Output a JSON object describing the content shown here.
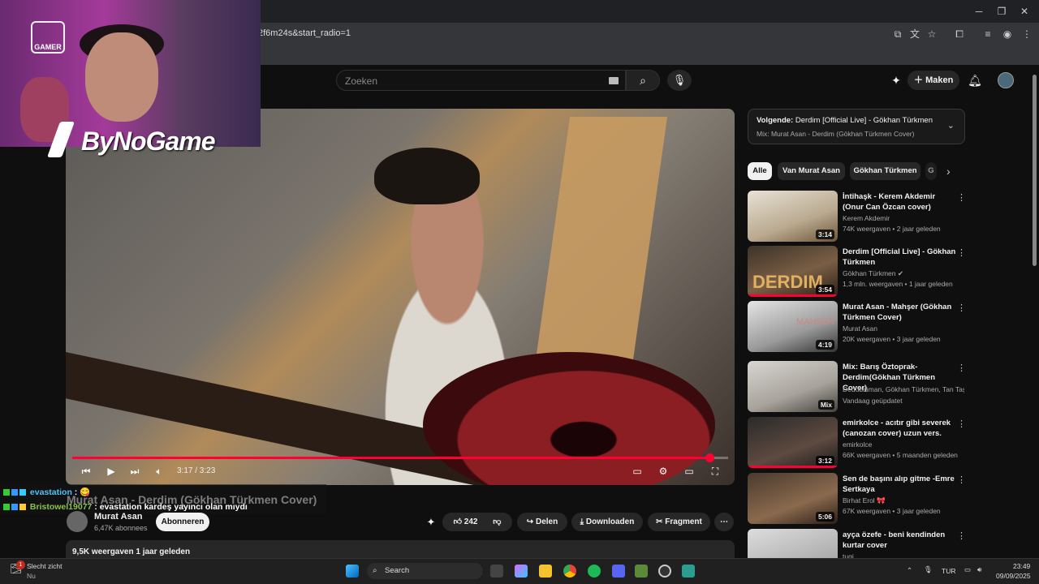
{
  "browser": {
    "url_fragment": "2f6m24s&start_radio=1"
  },
  "header": {
    "search_placeholder": "Zoeken",
    "create_label": "Maken"
  },
  "stream_overlay": {
    "brand": "ByNoGame",
    "logo_text": "GAMER"
  },
  "chat": [
    {
      "user": "evastation",
      "message": " : 😋"
    },
    {
      "user": "Bristowel19077",
      "message": " : evastation kardeş yayıncı olan mıydı"
    }
  ],
  "player": {
    "time": "3:17 / 3:23",
    "progress": 0.975
  },
  "video": {
    "title": "Murat Asan - Derdim (Gökhan Türkmen Cover)",
    "channel": "Murat Asan",
    "subscribers": "6,47K abonnees",
    "subscribe_label": "Abonneren",
    "likes": "242",
    "share_label": "Delen",
    "download_label": "Downloaden",
    "clip_label": "Fragment",
    "views_date": "9,5K weergaven  1 jaar geleden"
  },
  "next_up": {
    "prefix": "Volgende:",
    "title": " Derdim [Official Live] - Gökhan Türkmen",
    "mix": "Mix: Murat Asan - Derdim (Gökhan Türkmen Cover)"
  },
  "chips": [
    "Alle",
    "Van Murat Asan",
    "Gökhan Türkmen",
    "G"
  ],
  "recommendations": [
    {
      "title": "İntihaşk - Kerem Akdemir (Onur Can Özcan cover)",
      "channel": "Kerem Akdemir",
      "meta": "74K weergaven • 2 jaar geleden",
      "duration": "3:14",
      "progress": 0
    },
    {
      "title": "Derdim [Official Live] - Gökhan Türkmen",
      "channel": "Gökhan Türkmen ✔",
      "meta": "1,3 mln. weergaven • 1 jaar geleden",
      "duration": "3:54",
      "progress": 1,
      "overlay": "DERDIM"
    },
    {
      "title": "Murat Asan - Mahşer (Gökhan Türkmen Cover)",
      "channel": "Murat Asan",
      "meta": "20K weergaven • 3 jaar geleden",
      "duration": "4:19",
      "progress": 0,
      "overlay": "MAHŞER"
    },
    {
      "title": "Mix: Barış Öztoprak- Derdim(Gökhan Türkmen Cover)",
      "channel": "Dedublüman, Gökhan Türkmen, Tan Taşçı",
      "meta": "Vandaag geüpdatet",
      "duration": "Mix",
      "progress": 0
    },
    {
      "title": "emirkolce - acıtır gibi severek (canozan cover) uzun vers.",
      "channel": "emirkolce",
      "meta": "66K weergaven • 5 maanden geleden",
      "duration": "3:12",
      "progress": 1
    },
    {
      "title": "Sen de başını alıp gitme -Emre Sertkaya",
      "channel": "Birhat Erol 🎀",
      "meta": "67K weergaven • 3 jaar geleden",
      "duration": "5:06",
      "progress": 0
    },
    {
      "title": "ayça özefe - beni kendinden kurtar cover",
      "channel": "tugi",
      "meta": "",
      "duration": "",
      "progress": 0
    }
  ],
  "taskbar": {
    "weather_title": "Slecht zicht",
    "weather_sub": "Nu",
    "search_label": "Search",
    "lang": "TUR",
    "time": "23:49",
    "date": "09/09/2025",
    "notification_count": "1"
  }
}
